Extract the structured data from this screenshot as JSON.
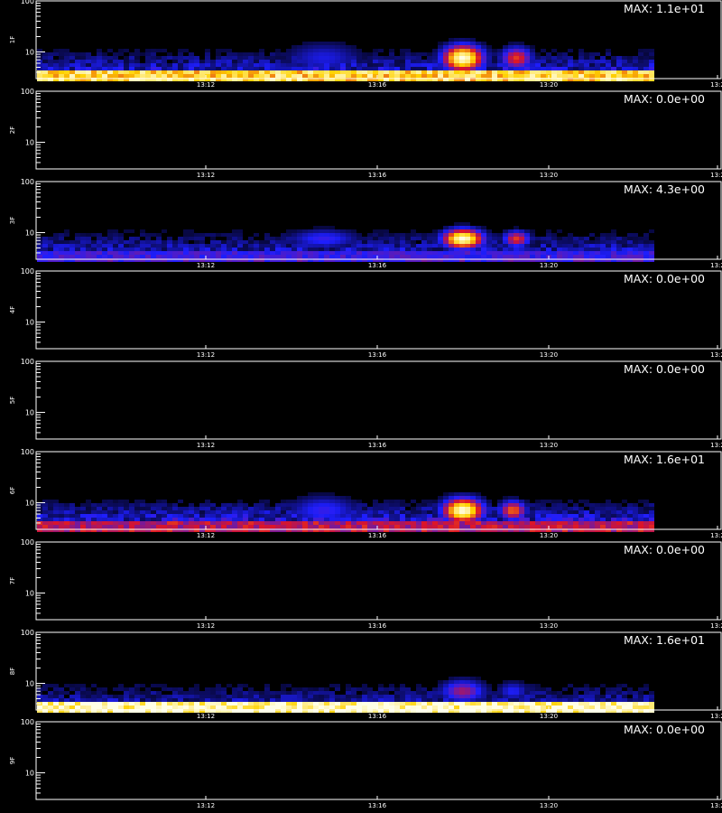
{
  "chart_data": {
    "type": "heatmap",
    "x_ticks": [
      "13:12",
      "13:16",
      "13:20",
      "13:2"
    ],
    "y_ticks": [
      "100",
      "10"
    ],
    "ylim": [
      3,
      100
    ],
    "y_scale": "log",
    "colormap": "black-blue-red-yellow-white",
    "colors": {
      "background": "#000000",
      "axes": "#ffffff",
      "text": "#ffffff"
    },
    "panels": [
      {
        "label": "1F",
        "max_label": "MAX: 1.1e+01",
        "max": 11.0,
        "blobs": [
          {
            "x": "13:18:00",
            "y": 7.5,
            "v": 1.0,
            "wx": 0.45,
            "wy": 0.16
          },
          {
            "x": "13:19:15",
            "y": 7.5,
            "v": 0.55,
            "wx": 0.35,
            "wy": 0.14
          },
          {
            "x": "13:14:45",
            "y": 7.5,
            "v": 0.22,
            "wx": 0.9,
            "wy": 0.2
          }
        ],
        "band": {
          "y": 3.4,
          "v": 0.8
        },
        "haze": 0.18
      },
      {
        "label": "2F",
        "max_label": "MAX: 0.0e+00",
        "max": 0.0,
        "blobs": [],
        "band": null,
        "haze": 0
      },
      {
        "label": "3F",
        "max_label": "MAX: 4.3e+00",
        "max": 4.3,
        "blobs": [
          {
            "x": "13:18:00",
            "y": 7.5,
            "v": 1.0,
            "wx": 0.45,
            "wy": 0.12
          },
          {
            "x": "13:19:15",
            "y": 7.5,
            "v": 0.55,
            "wx": 0.3,
            "wy": 0.1
          },
          {
            "x": "13:14:45",
            "y": 7.5,
            "v": 0.28,
            "wx": 0.8,
            "wy": 0.12
          }
        ],
        "band": {
          "y": 3.4,
          "v": 0.28
        },
        "haze": 0.16
      },
      {
        "label": "4F",
        "max_label": "MAX: 0.0e+00",
        "max": 0.0,
        "blobs": [],
        "band": null,
        "haze": 0
      },
      {
        "label": "5F",
        "max_label": "MAX: 0.0e+00",
        "max": 0.0,
        "blobs": [],
        "band": null,
        "haze": 0
      },
      {
        "label": "6F",
        "max_label": "MAX: 1.6e+01",
        "max": 16.0,
        "blobs": [
          {
            "x": "13:18:00",
            "y": 7.0,
            "v": 1.0,
            "wx": 0.45,
            "wy": 0.15
          },
          {
            "x": "13:19:10",
            "y": 7.0,
            "v": 0.62,
            "wx": 0.3,
            "wy": 0.12
          },
          {
            "x": "13:14:45",
            "y": 7.0,
            "v": 0.28,
            "wx": 0.8,
            "wy": 0.18
          }
        ],
        "band": {
          "y": 3.6,
          "v": 0.45
        },
        "haze": 0.2
      },
      {
        "label": "7F",
        "max_label": "MAX: 0.0e+00",
        "max": 0.0,
        "blobs": [],
        "band": null,
        "haze": 0
      },
      {
        "label": "8F",
        "max_label": "MAX: 1.6e+01",
        "max": 16.0,
        "blobs": [
          {
            "x": "13:18:00",
            "y": 7.0,
            "v": 0.42,
            "wx": 0.5,
            "wy": 0.14
          },
          {
            "x": "13:19:10",
            "y": 7.0,
            "v": 0.25,
            "wx": 0.35,
            "wy": 0.12
          }
        ],
        "band": {
          "y": 3.3,
          "v": 0.95
        },
        "haze": 0.14
      },
      {
        "label": "9F",
        "max_label": "MAX: 0.0e+00",
        "max": 0.0,
        "blobs": [],
        "band": null,
        "haze": 0
      }
    ]
  }
}
